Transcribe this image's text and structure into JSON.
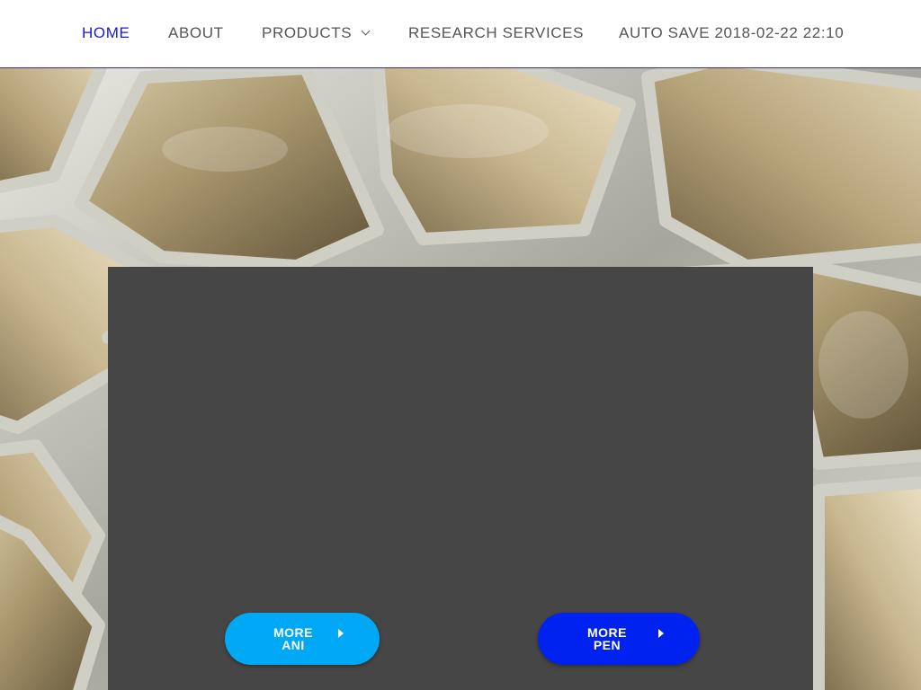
{
  "nav": {
    "items": [
      {
        "label": "HOME",
        "active": true
      },
      {
        "label": "ABOUT",
        "active": false
      },
      {
        "label": "PRODUCTS",
        "active": false,
        "has_dropdown": true
      },
      {
        "label": "RESEARCH SERVICES",
        "active": false
      },
      {
        "label": "AUTO SAVE 2018-02-22 22:10",
        "active": false
      }
    ]
  },
  "buttons": {
    "ani": {
      "line1": "MORE",
      "line2": "ANI",
      "icon": "caret-right-icon",
      "color": "#00a8f5"
    },
    "pen": {
      "line1": "MORE",
      "line2": "PEN",
      "icon": "caret-right-icon",
      "color": "#0022f0"
    }
  },
  "colors": {
    "nav_active": "#1a1acc",
    "nav_text": "#555555",
    "panel": "#464646"
  }
}
